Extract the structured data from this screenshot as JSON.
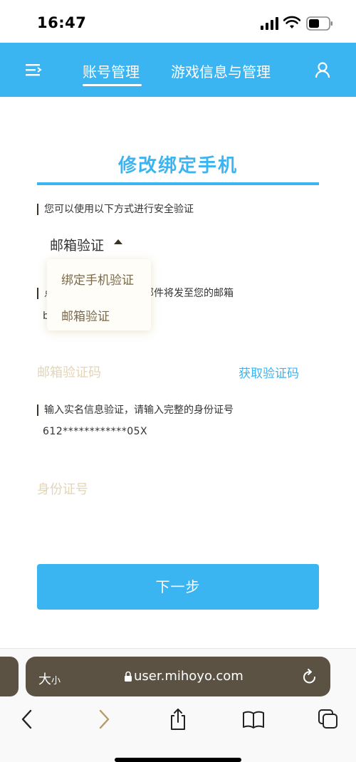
{
  "status_bar": {
    "time": "16:47"
  },
  "header": {
    "tabs": [
      {
        "label": "账号管理",
        "active": true
      },
      {
        "label": "游戏信息与管理",
        "active": false
      }
    ]
  },
  "page": {
    "title": "修改绑定手机",
    "verify_intro": "您可以使用以下方式进行安全验证",
    "selected_method": "邮箱验证",
    "dropdown_options": [
      "绑定手机验证",
      "邮箱验证"
    ],
    "email_notice": "点击获取验证码，验证邮件将发至您的邮箱",
    "email_notice_visible_start": "点",
    "email_notice_visible_end": "证邮件将发至您的邮箱",
    "email_partial": "b",
    "code_placeholder": "邮箱验证码",
    "get_code_label": "获取验证码",
    "id_prompt": "输入实名信息验证，请输入完整的身份证号",
    "id_masked": "612************05X",
    "id_placeholder": "身份证号",
    "next_label": "下一步"
  },
  "browser": {
    "text_size_label": "大",
    "text_size_small": "小",
    "url": "user.mihoyo.com"
  },
  "colors": {
    "accent": "#3bb4f2",
    "placeholder": "#e2d5b8",
    "browser_bar": "#5b5243"
  }
}
